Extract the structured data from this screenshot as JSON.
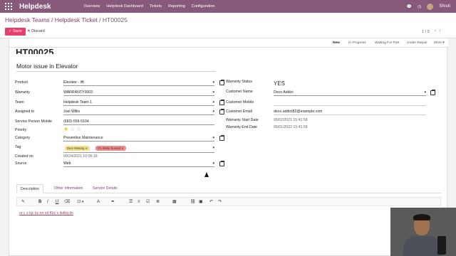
{
  "navbar": {
    "app_name": "Helpdesk",
    "menu": [
      "Overview",
      "Helpdesk Dashboard",
      "Tickets",
      "Reporting",
      "Configuration"
    ],
    "user_name": "Shruti",
    "icons": [
      "apps-grid-icon",
      "chat-icon",
      "clock-icon",
      "user-avatar"
    ]
  },
  "breadcrumb": {
    "teams": "Helpdesk Teams",
    "sep1": " / ",
    "ticket": "Helpdesk Ticket",
    "sep2": " / ",
    "current": "HT00025"
  },
  "actions": {
    "save": "Save",
    "discard": "Discard"
  },
  "pager": {
    "text": "1 / 9",
    "prev": "‹",
    "next": "›"
  },
  "stages": {
    "new": "New",
    "in_progress": "In Progress",
    "waiting": "Waiting For Part",
    "under_repair": "Under Repair",
    "more": "More"
  },
  "ticket": {
    "number": "HT00025",
    "subject": "Motor issue in Elevator"
  },
  "left_fields": {
    "product_label": "Product",
    "product_value": "Elevator - lift",
    "warranty_label": "Warranty",
    "warranty_value": "WARRANTY0003",
    "team_label": "Team",
    "team_value": "Helpdesk Team 1",
    "assigned_label": "Assigned to",
    "assigned_value": "Joel Willis",
    "mobile_label": "Service Person Mobile",
    "mobile_value": "(683)-556-5104",
    "priority_label": "Priority",
    "priority_stars": 1,
    "category_label": "Category",
    "category_value": "Preventive Maintenance",
    "tag_label": "Tag",
    "tag_1": "Door Missing",
    "tag_2": "ITL Motor burned",
    "created_label": "Created on",
    "created_value": "09/24/2021 10:06:18",
    "source_label": "Source",
    "source_value": "Web"
  },
  "right_fields": {
    "warranty_status_label": "Warranty Status",
    "warranty_status_value": "YES",
    "customer_name_label": "Customer Name",
    "customer_name_value": "Deco Addict",
    "customer_mobile_label": "Customer Mobile",
    "customer_mobile_value": "",
    "customer_email_label": "Customer Email",
    "customer_email_value": "deco.addict82@example.com",
    "warranty_start_label": "Warranty Start Date",
    "warranty_start_value": "05/02/2021 15:41:58",
    "warranty_end_label": "Warranty End Date",
    "warranty_end_value": "05/01/2022 15:41:58"
  },
  "tabs": {
    "description": "Description",
    "other": "Other Information",
    "service": "Service Details"
  },
  "editor": {
    "font_size": "13",
    "content": "ur c z kjc kz nn xd Kkc v ikdkq ds"
  },
  "colors": {
    "brand": "#875a7b",
    "save": "#e83e6b",
    "link": "#7c3e6a",
    "star": "#f3cc00",
    "tag1": "#f3e28b",
    "tag2": "#f28b8b"
  }
}
